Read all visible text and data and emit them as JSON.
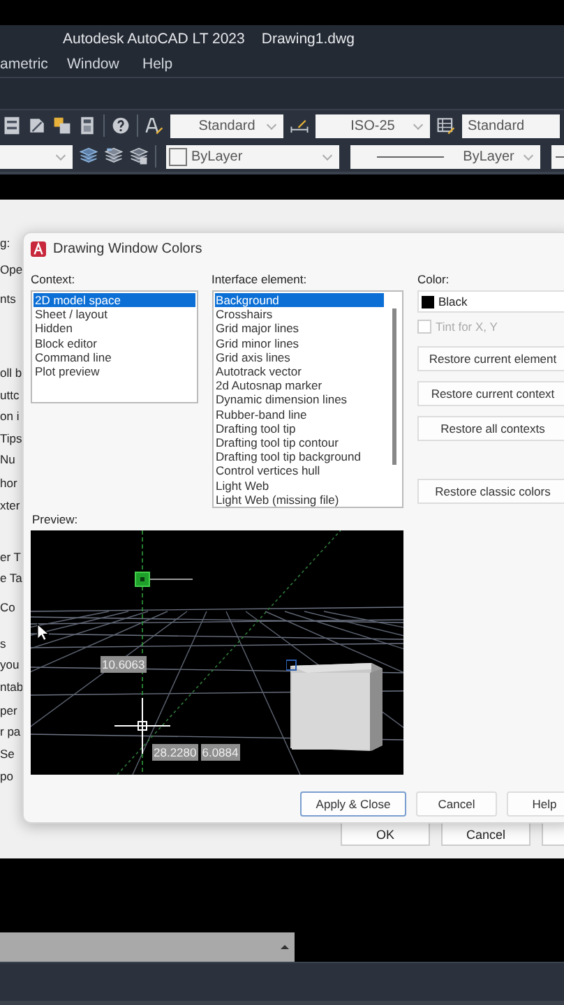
{
  "app": {
    "title": "Autodesk AutoCAD LT 2023",
    "document": "Drawing1.dwg"
  },
  "menu": [
    "ametric",
    "Window",
    "Help"
  ],
  "toolbar": {
    "text_style": "Standard",
    "dim_style": "ISO-25",
    "table_style": "Standard",
    "layer_color": "ByLayer",
    "linetype": "ByLayer"
  },
  "options_dialog": {
    "fragments": [
      "g:",
      "Ope",
      "nts",
      "oll b",
      "uttc",
      "on i",
      "Tips",
      "Nu",
      "hor",
      "xter",
      "er T",
      "e Ta",
      "Co",
      "s",
      "you",
      "ntab",
      "per",
      "r pa",
      "Se",
      "po"
    ],
    "buttons": [
      "OK",
      "Cancel"
    ]
  },
  "dialog": {
    "title": "Drawing Window Colors",
    "context_label": "Context:",
    "contexts": [
      {
        "label": "2D model space",
        "selected": true
      },
      {
        "label": "Sheet / layout",
        "selected": false
      },
      {
        "label": "Hidden",
        "selected": false
      },
      {
        "label": "Block editor",
        "selected": false
      },
      {
        "label": "Command line",
        "selected": false
      },
      {
        "label": "Plot preview",
        "selected": false
      }
    ],
    "element_label": "Interface element:",
    "elements": [
      {
        "label": "Background",
        "selected": true
      },
      {
        "label": "Crosshairs",
        "selected": false
      },
      {
        "label": "Grid major lines",
        "selected": false
      },
      {
        "label": "Grid minor lines",
        "selected": false
      },
      {
        "label": "Grid axis lines",
        "selected": false
      },
      {
        "label": "Autotrack vector",
        "selected": false
      },
      {
        "label": "2d Autosnap marker",
        "selected": false
      },
      {
        "label": "Dynamic dimension lines",
        "selected": false
      },
      {
        "label": "Rubber-band line",
        "selected": false
      },
      {
        "label": "Drafting tool tip",
        "selected": false
      },
      {
        "label": "Drafting tool tip contour",
        "selected": false
      },
      {
        "label": "Drafting tool tip background",
        "selected": false
      },
      {
        "label": "Control vertices hull",
        "selected": false
      },
      {
        "label": "Light Web",
        "selected": false
      },
      {
        "label": "Light Web (missing file)",
        "selected": false
      }
    ],
    "color_label": "Color:",
    "color": {
      "name": "Black"
    },
    "tint": {
      "label": "Tint for X, Y",
      "checked": false,
      "disabled": true
    },
    "restore_buttons": [
      "Restore current element",
      "Restore current context",
      "Restore all contexts",
      "Restore classic colors"
    ],
    "preview_label": "Preview:",
    "preview": {
      "readouts": [
        "10.6063",
        "28.2280",
        "6.0884"
      ]
    },
    "buttons": [
      {
        "label": "Apply & Close",
        "default": true
      },
      {
        "label": "Cancel",
        "default": false
      },
      {
        "label": "Help",
        "default": false
      }
    ]
  }
}
